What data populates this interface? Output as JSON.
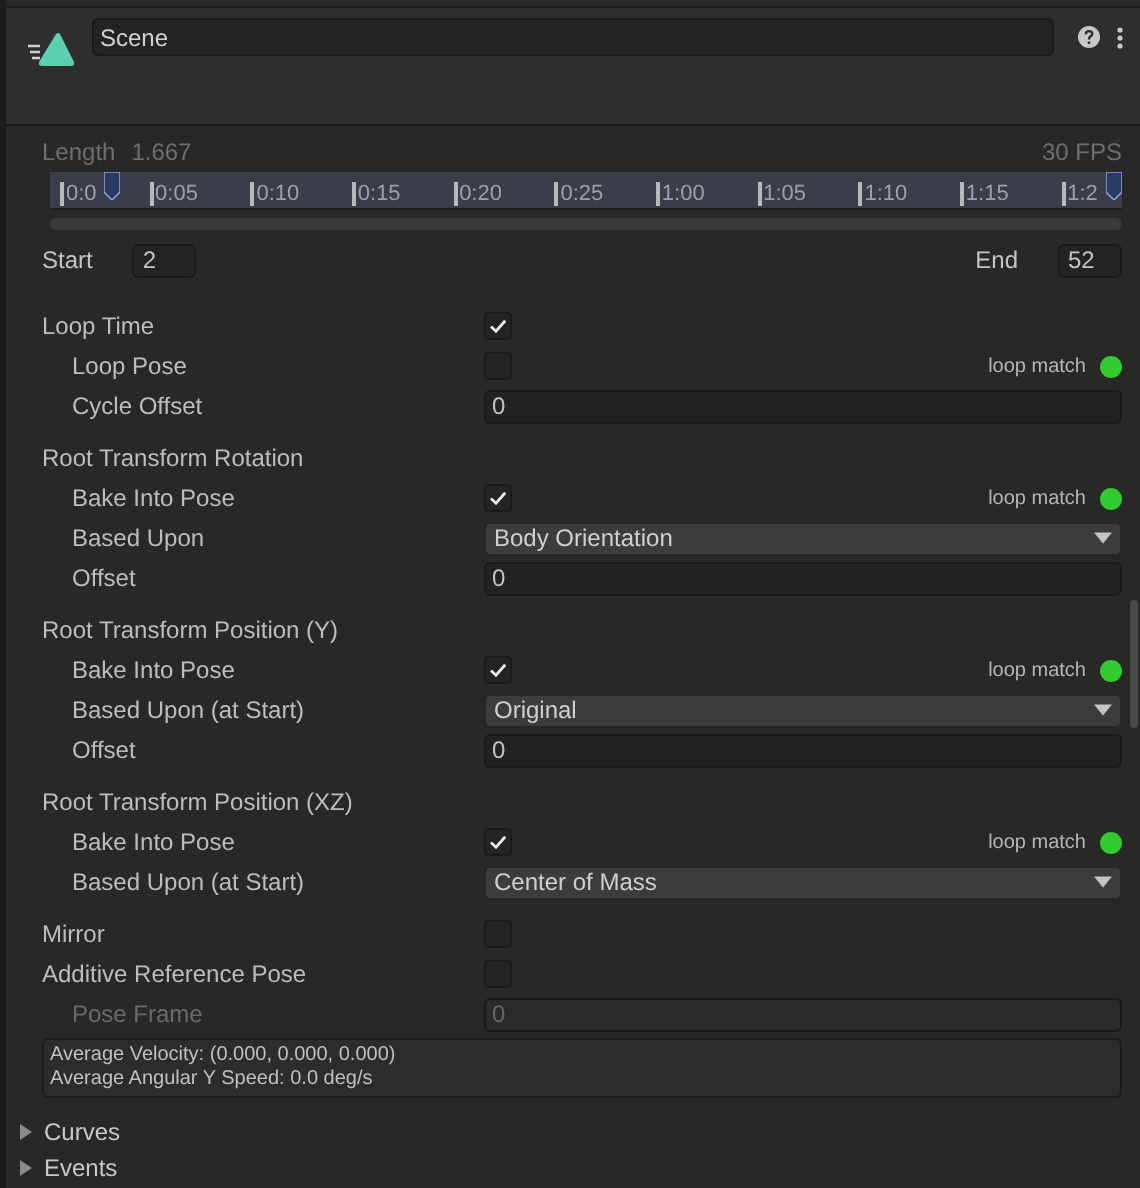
{
  "header": {
    "name": "Scene"
  },
  "timeline": {
    "length_label": "Length",
    "length": "1.667",
    "fps": "30 FPS",
    "ticks": [
      "0:0",
      "0:05",
      "0:10",
      "0:15",
      "0:20",
      "0:25",
      "1:00",
      "1:05",
      "1:10",
      "1:15",
      "1:2"
    ]
  },
  "range": {
    "start_label": "Start",
    "start": "2",
    "end_label": "End",
    "end": "52"
  },
  "properties": [
    {
      "kind": "checkbox",
      "label": "Loop Time",
      "checked": true,
      "children": [
        {
          "kind": "checkbox",
          "label": "Loop Pose",
          "checked": false,
          "match": {
            "text": "loop match",
            "color": "#2ecc2e"
          }
        },
        {
          "kind": "field",
          "label": "Cycle Offset",
          "value": "0"
        }
      ]
    },
    {
      "kind": "section",
      "label": "Root Transform Rotation",
      "children": [
        {
          "kind": "checkbox",
          "label": "Bake Into Pose",
          "checked": true,
          "match": {
            "text": "loop match",
            "color": "#2ecc2e"
          }
        },
        {
          "kind": "dropdown",
          "label": "Based Upon",
          "value": "Body Orientation"
        },
        {
          "kind": "field",
          "label": "Offset",
          "value": "0"
        }
      ]
    },
    {
      "kind": "section",
      "label": "Root Transform Position (Y)",
      "children": [
        {
          "kind": "checkbox",
          "label": "Bake Into Pose",
          "checked": true,
          "match": {
            "text": "loop match",
            "color": "#2ecc2e"
          }
        },
        {
          "kind": "dropdown",
          "label": "Based Upon (at Start)",
          "value": "Original"
        },
        {
          "kind": "field",
          "label": "Offset",
          "value": "0"
        }
      ]
    },
    {
      "kind": "section",
      "label": "Root Transform Position (XZ)",
      "children": [
        {
          "kind": "checkbox",
          "label": "Bake Into Pose",
          "checked": true,
          "match": {
            "text": "loop match",
            "color": "#2ecc2e"
          }
        },
        {
          "kind": "dropdown",
          "label": "Based Upon (at Start)",
          "value": "Center of Mass"
        }
      ]
    },
    {
      "kind": "checkbox",
      "label": "Mirror",
      "checked": false
    },
    {
      "kind": "checkbox",
      "label": "Additive Reference Pose",
      "checked": false,
      "children": [
        {
          "kind": "field",
          "label": "Pose Frame",
          "value": "0",
          "disabled": true
        }
      ]
    }
  ],
  "info": [
    "Average Velocity: (0.000, 0.000, 0.000)",
    "Average Angular Y Speed: 0.0 deg/s"
  ],
  "foldouts": [
    {
      "label": "Curves",
      "expanded": false
    },
    {
      "label": "Events",
      "expanded": false
    }
  ]
}
